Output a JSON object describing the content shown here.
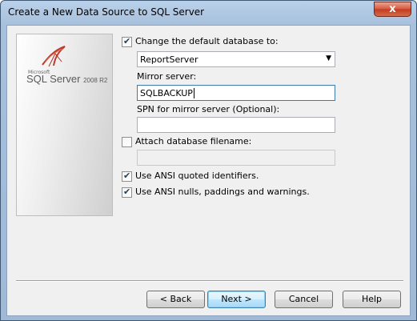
{
  "window": {
    "title": "Create a New Data Source to SQL Server",
    "close_glyph": "x"
  },
  "banner": {
    "brand_small": "Microsoft",
    "brand": "SQL Server",
    "version": "2008 R2"
  },
  "options": {
    "change_db": {
      "label": "Change the default database to:",
      "checked": true,
      "value": "ReportServer"
    },
    "mirror": {
      "label": "Mirror server:",
      "value": "SQLBACKUP"
    },
    "spn": {
      "label": "SPN for mirror server (Optional):",
      "value": ""
    },
    "attach": {
      "label": "Attach database filename:",
      "checked": false,
      "value": ""
    },
    "ansi_quoted": {
      "label": "Use ANSI quoted identifiers.",
      "checked": true
    },
    "ansi_nulls": {
      "label": "Use ANSI nulls, paddings and warnings.",
      "checked": true
    }
  },
  "buttons": {
    "back": "< Back",
    "next": "Next >",
    "cancel": "Cancel",
    "help": "Help"
  },
  "colors": {
    "accent": "#3c7fb1",
    "logo_red": "#c0392b"
  }
}
